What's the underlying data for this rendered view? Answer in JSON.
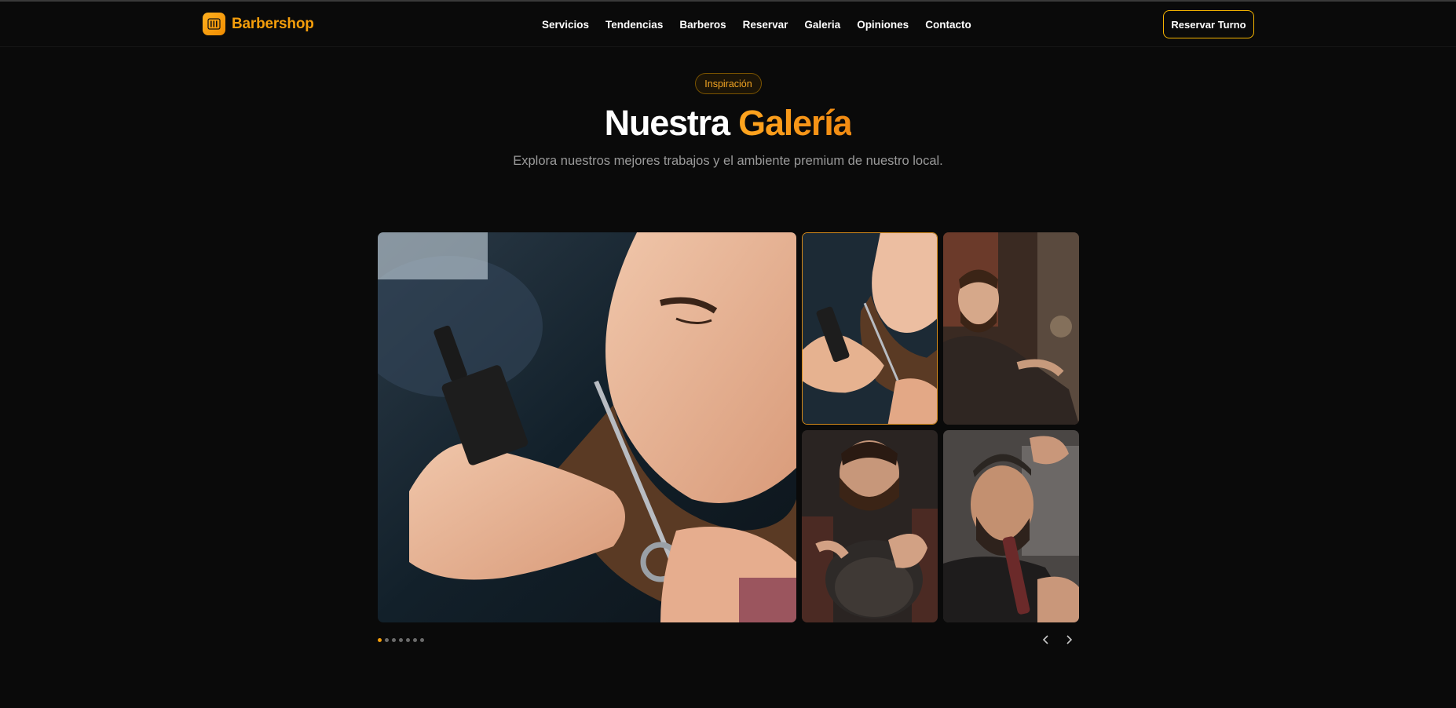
{
  "header": {
    "logo_text": "Barbershop",
    "logo_icon": "barber-pole-icon",
    "nav": [
      "Servicios",
      "Tendencias",
      "Barberos",
      "Reservar",
      "Galeria",
      "Opiniones",
      "Contacto"
    ],
    "cta_label": "Reservar Turno"
  },
  "section": {
    "badge": "Inspiración",
    "title_plain": "Nuestra",
    "title_accent": "Galería",
    "subtitle": "Explora nuestros mejores trabajos y el ambiente premium de nuestro local."
  },
  "gallery": {
    "active_index": 0,
    "total_slides": 7,
    "prev_icon": "chevron-left-icon",
    "next_icon": "chevron-right-icon"
  },
  "colors": {
    "accent": "#f59e0b",
    "background": "#0a0a0a",
    "muted_text": "#9a9a9a"
  }
}
